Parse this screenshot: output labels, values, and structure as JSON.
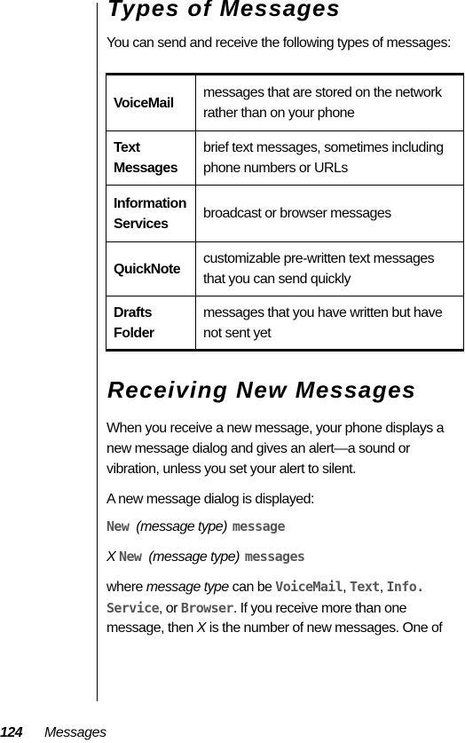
{
  "section1": {
    "title": "Types of Messages",
    "intro": "You can send and receive the following types of messages:",
    "table": [
      {
        "label_lines": [
          "VoiceMail"
        ],
        "description_lines": [
          "messages that are stored on the network",
          "rather than on your phone"
        ]
      },
      {
        "label_lines": [
          "Text",
          "Messages"
        ],
        "description_lines": [
          "brief text messages, sometimes including",
          "phone numbers or URLs"
        ]
      },
      {
        "label_lines": [
          "Information",
          "Services"
        ],
        "description_lines": [
          "broadcast or browser messages"
        ]
      },
      {
        "label_lines": [
          "QuickNote"
        ],
        "description_lines": [
          "customizable pre-written text messages",
          "that you can send quickly"
        ]
      },
      {
        "label_lines": [
          "Drafts",
          "Folder"
        ],
        "description_lines": [
          "messages that you have written but have",
          "not sent yet"
        ]
      }
    ]
  },
  "section2": {
    "title": "Receiving New Messages",
    "paragraph1_lines": [
      "When you receive a new message, your phone displays a",
      "new message dialog and gives an alert—a sound or",
      "vibration, unless you set your alert to silent."
    ],
    "paragraph2": "A new message dialog is displayed:",
    "dialog1": {
      "new": "New",
      "type": "(message type)",
      "suffix": "message"
    },
    "dialog2": {
      "count": "X",
      "new": "New",
      "type": "(message type)",
      "suffix": "messages"
    },
    "where": {
      "line1": {
        "a": "where ",
        "b": "message type",
        "c": " can be ",
        "d": "VoiceMail",
        "e": ", ",
        "f": "Text",
        "g": ", ",
        "h": "Info."
      },
      "line2": {
        "a": "Service",
        "b": ", or ",
        "c": "Browser",
        "d": ". If you receive more than one"
      },
      "line3": {
        "a": "message, then ",
        "b": "X",
        "c": " is the number of new messages. One of"
      }
    }
  },
  "footer": {
    "page_number": "124",
    "section": "Messages"
  },
  "colors": {
    "text": "#000000",
    "display_text": "#555555",
    "rule": "#000000"
  }
}
